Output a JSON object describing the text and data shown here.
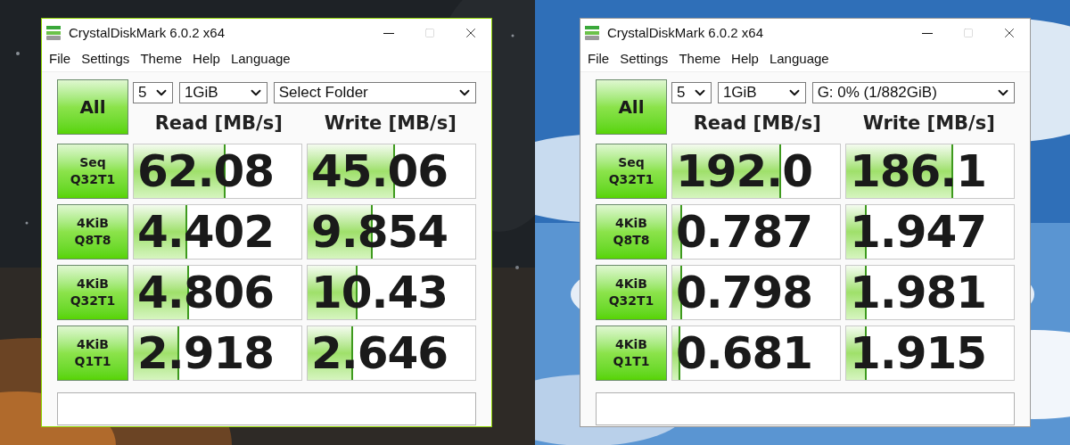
{
  "windows": [
    {
      "active": true,
      "title": "CrystalDiskMark 6.0.2 x64",
      "menu": [
        "File",
        "Settings",
        "Theme",
        "Help",
        "Language"
      ],
      "all_button": "All",
      "count": "5",
      "size": "1GiB",
      "target": "Select Folder",
      "headers": [
        "Read [MB/s]",
        "Write [MB/s]"
      ],
      "tests": [
        {
          "name": "Seq",
          "params": "Q32T1",
          "read": {
            "value": "62.08",
            "level": 0.55
          },
          "write": {
            "value": "45.06",
            "level": 0.52
          }
        },
        {
          "name": "4KiB",
          "params": "Q8T8",
          "read": {
            "value": "4.402",
            "level": 0.32
          },
          "write": {
            "value": "9.854",
            "level": 0.39
          }
        },
        {
          "name": "4KiB",
          "params": "Q32T1",
          "read": {
            "value": "4.806",
            "level": 0.33
          },
          "write": {
            "value": "10.43",
            "level": 0.3
          }
        },
        {
          "name": "4KiB",
          "params": "Q1T1",
          "read": {
            "value": "2.918",
            "level": 0.27
          },
          "write": {
            "value": "2.646",
            "level": 0.27
          }
        }
      ]
    },
    {
      "active": false,
      "title": "CrystalDiskMark 6.0.2 x64",
      "menu": [
        "File",
        "Settings",
        "Theme",
        "Help",
        "Language"
      ],
      "all_button": "All",
      "count": "5",
      "size": "1GiB",
      "target": "G: 0% (1/882GiB)",
      "headers": [
        "Read [MB/s]",
        "Write [MB/s]"
      ],
      "tests": [
        {
          "name": "Seq",
          "params": "Q32T1",
          "read": {
            "value": "192.0",
            "level": 0.65
          },
          "write": {
            "value": "186.1",
            "level": 0.64
          }
        },
        {
          "name": "4KiB",
          "params": "Q8T8",
          "read": {
            "value": "0.787",
            "level": 0.06
          },
          "write": {
            "value": "1.947",
            "level": 0.12
          }
        },
        {
          "name": "4KiB",
          "params": "Q32T1",
          "read": {
            "value": "0.798",
            "level": 0.06
          },
          "write": {
            "value": "1.981",
            "level": 0.12
          }
        },
        {
          "name": "4KiB",
          "params": "Q1T1",
          "read": {
            "value": "0.681",
            "level": 0.05
          },
          "write": {
            "value": "1.915",
            "level": 0.12
          }
        }
      ]
    }
  ]
}
